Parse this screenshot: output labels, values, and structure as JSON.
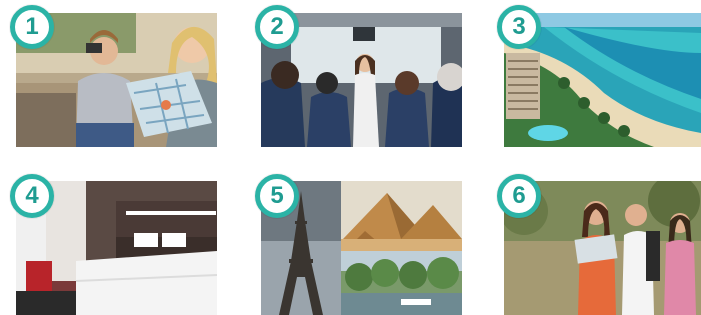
{
  "accent_color": "#2bb3a6",
  "photos": [
    {
      "number": "1",
      "scene": "tourists-with-map"
    },
    {
      "number": "2",
      "scene": "tour-bus-with-guide"
    },
    {
      "number": "3",
      "scene": "beach-resort-aerial"
    },
    {
      "number": "4",
      "scene": "hotel-room"
    },
    {
      "number": "5",
      "scene": "eiffel-tower-and-pyramids"
    },
    {
      "number": "6",
      "scene": "hikers-in-nature"
    }
  ]
}
